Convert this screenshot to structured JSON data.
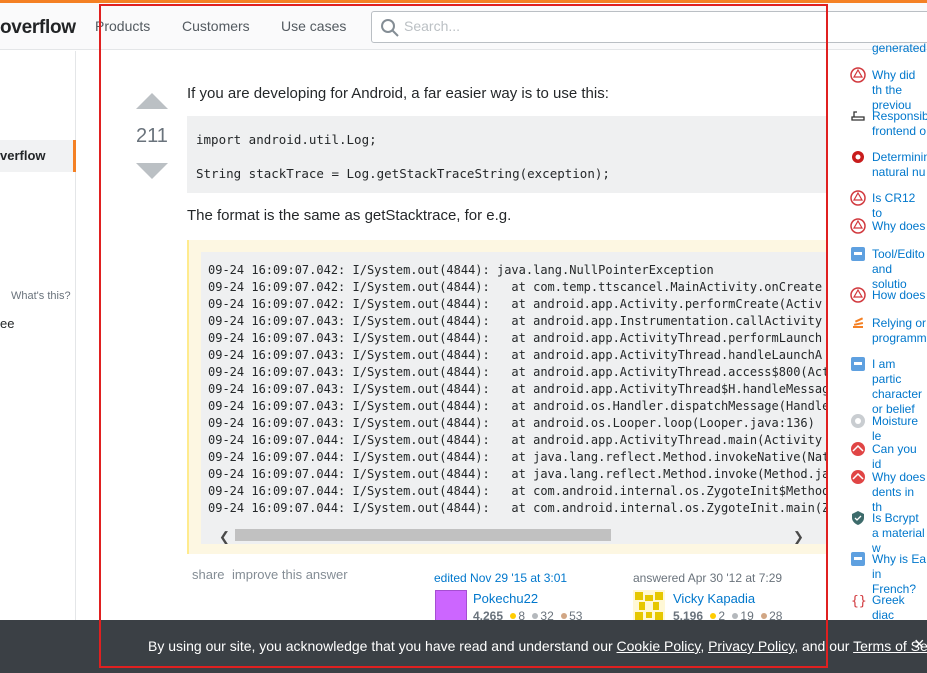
{
  "header": {
    "logo_text": "overflow",
    "nav": [
      "Products",
      "Customers",
      "Use cases"
    ],
    "search_placeholder": "Search..."
  },
  "left_nav": {
    "active_item": "verflow",
    "whats_this": "What's this?",
    "partial_item": "ee"
  },
  "answer": {
    "score": "211",
    "intro": "If you are developing for Android, a far easier way is to use this:",
    "snippet_lines": [
      "import android.util.Log;",
      "",
      "String stackTrace = Log.getStackTraceString(exception);"
    ],
    "format_note": "The format is the same as getStacktrace, for e.g.",
    "log_lines": [
      "09-24 16:09:07.042: I/System.out(4844): java.lang.NullPointerException",
      "09-24 16:09:07.042: I/System.out(4844):   at com.temp.ttscancel.MainActivity.onCreate",
      "09-24 16:09:07.042: I/System.out(4844):   at android.app.Activity.performCreate(Activ",
      "09-24 16:09:07.043: I/System.out(4844):   at android.app.Instrumentation.callActivity",
      "09-24 16:09:07.043: I/System.out(4844):   at android.app.ActivityThread.performLaunch",
      "09-24 16:09:07.043: I/System.out(4844):   at android.app.ActivityThread.handleLaunchA",
      "09-24 16:09:07.043: I/System.out(4844):   at android.app.ActivityThread.access$800(Act",
      "09-24 16:09:07.043: I/System.out(4844):   at android.app.ActivityThread$H.handleMessag",
      "09-24 16:09:07.043: I/System.out(4844):   at android.os.Handler.dispatchMessage(Handle",
      "09-24 16:09:07.043: I/System.out(4844):   at android.os.Looper.loop(Looper.java:136)",
      "09-24 16:09:07.044: I/System.out(4844):   at android.app.ActivityThread.main(Activity",
      "09-24 16:09:07.044: I/System.out(4844):   at java.lang.reflect.Method.invokeNative(Nat",
      "09-24 16:09:07.044: I/System.out(4844):   at java.lang.reflect.Method.invoke(Method.ja",
      "09-24 16:09:07.044: I/System.out(4844):   at com.android.internal.os.ZygoteInit$Method",
      "09-24 16:09:07.044: I/System.out(4844):   at com.android.internal.os.ZygoteInit.main(Z"
    ],
    "menu": {
      "share": "share",
      "improve": "improve this answer"
    },
    "edited": {
      "label": "edited Nov 29 '15 at 3:01",
      "name": "Pokechu22",
      "rep": "4,265",
      "gold": "8",
      "silver": "32",
      "bronze": "53"
    },
    "answered": {
      "label": "answered Apr 30 '12 at 7:29",
      "name": "Vicky Kapadia",
      "rep": "5,196",
      "gold": "2",
      "silver": "19",
      "bronze": "28"
    }
  },
  "hot_questions": [
    {
      "text": "generated",
      "icon": "site-icon-generic"
    },
    {
      "text": "Why did th the previou",
      "icon": "site-icon-red-hex"
    },
    {
      "text": "Responsib frontend o",
      "icon": "site-icon-bath"
    },
    {
      "text": "Determinin natural nu",
      "icon": "site-icon-red-gear"
    },
    {
      "text": "Is CR12 to",
      "icon": "site-icon-red-hex"
    },
    {
      "text": "Why does",
      "icon": "site-icon-red-hex"
    },
    {
      "text": "Tool/Edito and solutio",
      "icon": "site-icon-blue-square"
    },
    {
      "text": "How does",
      "icon": "site-icon-red-hex"
    },
    {
      "text": "Relying or programm",
      "icon": "site-icon-stack"
    },
    {
      "text": "I am partic character or belief",
      "icon": "site-icon-blue-square"
    },
    {
      "text": "Moisture le",
      "icon": "site-icon-gray-circle"
    },
    {
      "text": "Can you id",
      "icon": "site-icon-red-circle"
    },
    {
      "text": "Why does dents in th",
      "icon": "site-icon-red-circle"
    },
    {
      "text": "Is Bcrypt a material w",
      "icon": "site-icon-shield"
    },
    {
      "text": "Why is Ea in French?",
      "icon": "site-icon-blue-square"
    },
    {
      "text": "Greek diac",
      "icon": "site-icon-braces"
    }
  ],
  "cookie_banner": {
    "prefix": "By using our site, you acknowledge that you have read and understand our ",
    "cookie_policy": "Cookie Policy",
    "sep1": ", ",
    "privacy_policy": "Privacy Policy",
    "sep2": ", and our ",
    "terms": "Terms of Service",
    "suffix": ".",
    "close": "×"
  },
  "colors": {
    "brand_orange": "#f48024",
    "link_blue": "#0077cc",
    "annotation_red": "#e02020"
  }
}
